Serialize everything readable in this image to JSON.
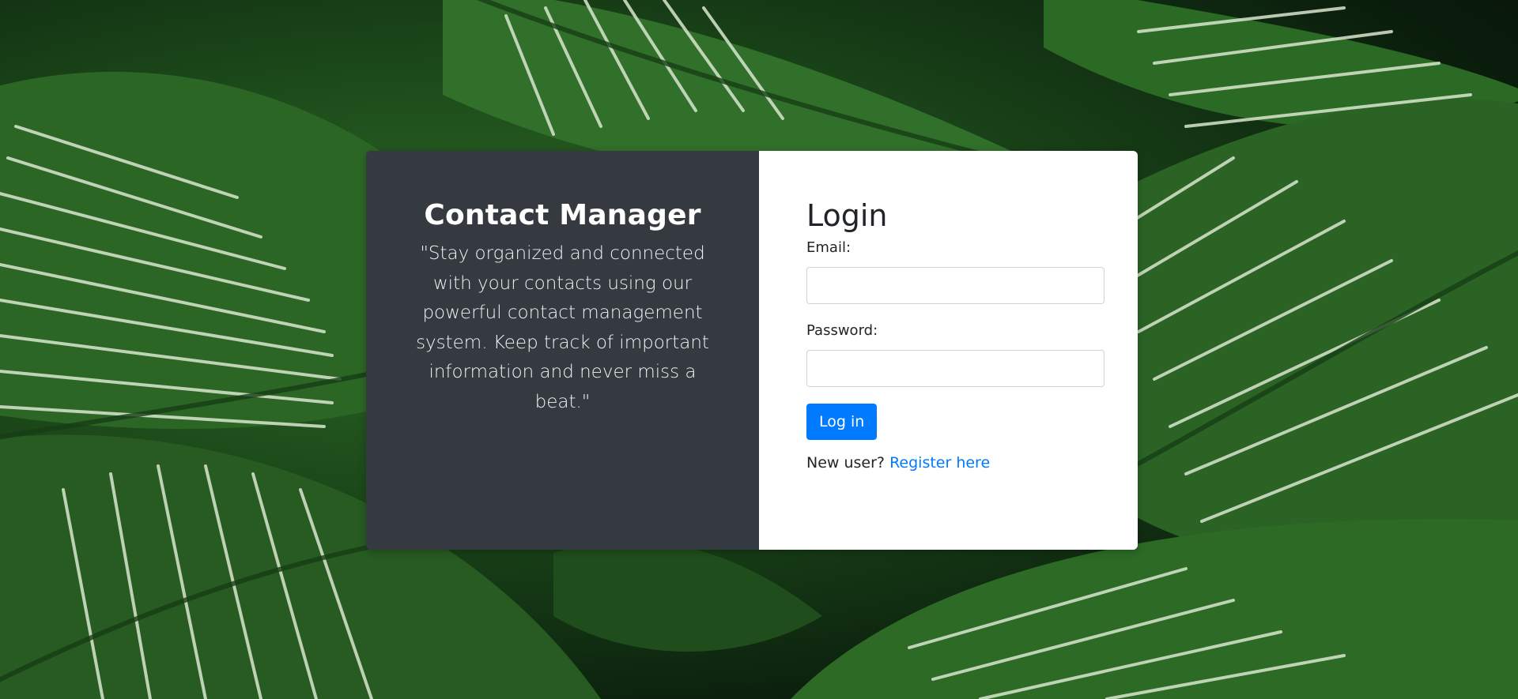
{
  "brand": {
    "title": "Contact Manager",
    "quote": "\"Stay organized and connected with your contacts using our powerful contact management system. Keep track of important information and never miss a beat.\""
  },
  "login": {
    "title": "Login",
    "email_label": "Email:",
    "email_value": "",
    "password_label": "Password:",
    "password_value": "",
    "submit_label": "Log in",
    "register_prompt": "New user?",
    "register_link": "Register here"
  },
  "colors": {
    "brand_panel_bg": "#343a40",
    "accent": "#007bff",
    "form_panel_bg": "#ffffff",
    "background_foliage": "#2f6b27"
  }
}
